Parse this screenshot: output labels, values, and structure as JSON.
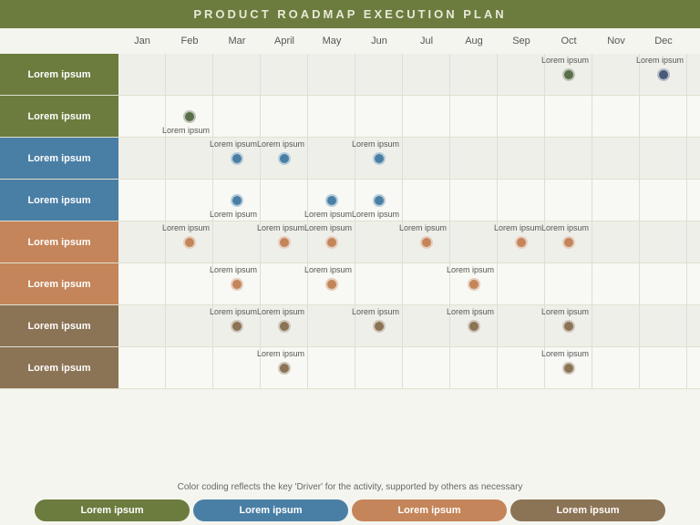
{
  "header": {
    "title": "PRODUCT ROADMAP EXECUTION PLAN"
  },
  "months": [
    "Jan",
    "Feb",
    "Mar",
    "April",
    "May",
    "Jun",
    "Jul",
    "Aug",
    "Sep",
    "Oct",
    "Nov",
    "Dec"
  ],
  "rows": [
    {
      "label": "Lorem ipsum",
      "color": "#6b7c3e",
      "milestones": [
        {
          "col": 9,
          "offset": 0.5,
          "color": "#5a6e4a",
          "label": "Lorem ipsum",
          "labelPos": "above"
        },
        {
          "col": 11,
          "offset": 0.5,
          "color": "#4a5a7a",
          "label": "Lorem ipsum",
          "labelPos": "above"
        }
      ]
    },
    {
      "label": "Lorem ipsum",
      "color": "#6b7c3e",
      "milestones": [
        {
          "col": 1,
          "offset": 0.5,
          "color": "#5a6e4a",
          "label": "Lorem ipsum",
          "labelPos": "below"
        }
      ]
    },
    {
      "label": "Lorem ipsum",
      "color": "#4a7fa5",
      "milestones": [
        {
          "col": 2,
          "offset": 0.5,
          "color": "#4a7fa5",
          "label": "Lorem ipsum",
          "labelPos": "above"
        },
        {
          "col": 3,
          "offset": 0.5,
          "color": "#4a7fa5",
          "label": "Lorem ipsum",
          "labelPos": "above"
        },
        {
          "col": 5,
          "offset": 0.5,
          "color": "#4a7fa5",
          "label": "Lorem ipsum",
          "labelPos": "above"
        }
      ]
    },
    {
      "label": "Lorem ipsum",
      "color": "#4a7fa5",
      "milestones": [
        {
          "col": 2,
          "offset": 0.5,
          "color": "#4a7fa5",
          "label": "Lorem ipsum",
          "labelPos": "below"
        },
        {
          "col": 4,
          "offset": 0.5,
          "color": "#4a7fa5",
          "label": "Lorem ipsum",
          "labelPos": "below"
        },
        {
          "col": 5,
          "offset": 0.5,
          "color": "#4a7fa5",
          "label": "Lorem ipsum",
          "labelPos": "below"
        }
      ]
    },
    {
      "label": "Lorem ipsum",
      "color": "#c4855a",
      "milestones": [
        {
          "col": 1,
          "offset": 0.5,
          "color": "#c4855a",
          "label": "Lorem ipsum",
          "labelPos": "above"
        },
        {
          "col": 3,
          "offset": 0.5,
          "color": "#c4855a",
          "label": "Lorem ipsum",
          "labelPos": "above"
        },
        {
          "col": 4,
          "offset": 0.5,
          "color": "#c4855a",
          "label": "Lorem ipsum",
          "labelPos": "above"
        },
        {
          "col": 6,
          "offset": 0.5,
          "color": "#c4855a",
          "label": "Lorem ipsum",
          "labelPos": "above"
        },
        {
          "col": 8,
          "offset": 0.5,
          "color": "#c4855a",
          "label": "Lorem ipsum",
          "labelPos": "above"
        },
        {
          "col": 9,
          "offset": 0.5,
          "color": "#c4855a",
          "label": "Lorem ipsum",
          "labelPos": "above"
        }
      ]
    },
    {
      "label": "Lorem ipsum",
      "color": "#c4855a",
      "milestones": [
        {
          "col": 2,
          "offset": 0.5,
          "color": "#c4855a",
          "label": "Lorem ipsum",
          "labelPos": "above"
        },
        {
          "col": 4,
          "offset": 0.5,
          "color": "#c4855a",
          "label": "Lorem ipsum",
          "labelPos": "above"
        },
        {
          "col": 7,
          "offset": 0.5,
          "color": "#c4855a",
          "label": "Lorem ipsum",
          "labelPos": "above"
        }
      ]
    },
    {
      "label": "Lorem ipsum",
      "color": "#8b7355",
      "milestones": [
        {
          "col": 2,
          "offset": 0.5,
          "color": "#8b7355",
          "label": "Lorem ipsum",
          "labelPos": "above"
        },
        {
          "col": 3,
          "offset": 0.5,
          "color": "#8b7355",
          "label": "Lorem ipsum",
          "labelPos": "above"
        },
        {
          "col": 5,
          "offset": 0.5,
          "color": "#8b7355",
          "label": "Lorem ipsum",
          "labelPos": "above"
        },
        {
          "col": 7,
          "offset": 0.5,
          "color": "#8b7355",
          "label": "Lorem ipsum",
          "labelPos": "above"
        },
        {
          "col": 9,
          "offset": 0.5,
          "color": "#8b7355",
          "label": "Lorem ipsum",
          "labelPos": "above"
        }
      ]
    },
    {
      "label": "Lorem ipsum",
      "color": "#8b7355",
      "milestones": [
        {
          "col": 3,
          "offset": 0.5,
          "color": "#8b7355",
          "label": "Lorem ipsum",
          "labelPos": "above"
        },
        {
          "col": 9,
          "offset": 0.5,
          "color": "#8b7355",
          "label": "Lorem ipsum",
          "labelPos": "above"
        }
      ]
    }
  ],
  "legend_text": "Color coding reflects the key 'Driver' for the activity, supported by others as necessary",
  "footer_pills": [
    {
      "label": "Lorem ipsum",
      "color": "#6b7c3e"
    },
    {
      "label": "Lorem ipsum",
      "color": "#4a7fa5"
    },
    {
      "label": "Lorem ipsum",
      "color": "#c4855a"
    },
    {
      "label": "Lorem ipsum",
      "color": "#8b7355"
    }
  ]
}
